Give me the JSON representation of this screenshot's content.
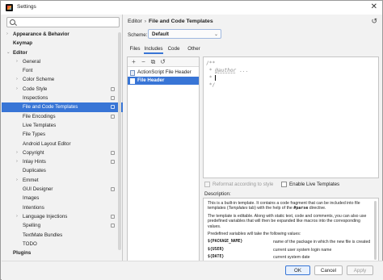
{
  "window": {
    "title": "Settings",
    "close": "✕"
  },
  "sidebar": {
    "items": [
      {
        "label": "Appearance & Behavior",
        "bold": true,
        "arrow": "›",
        "indent": 0,
        "proj": false,
        "selected": false
      },
      {
        "label": "Keymap",
        "bold": true,
        "arrow": "",
        "indent": 0,
        "proj": false,
        "selected": false
      },
      {
        "label": "Editor",
        "bold": true,
        "arrow": "⌄",
        "indent": 0,
        "proj": false,
        "selected": false
      },
      {
        "label": "General",
        "bold": false,
        "arrow": "›",
        "indent": 1,
        "proj": false,
        "selected": false
      },
      {
        "label": "Font",
        "bold": false,
        "arrow": "",
        "indent": 1,
        "proj": false,
        "selected": false
      },
      {
        "label": "Color Scheme",
        "bold": false,
        "arrow": "›",
        "indent": 1,
        "proj": false,
        "selected": false
      },
      {
        "label": "Code Style",
        "bold": false,
        "arrow": "›",
        "indent": 1,
        "proj": true,
        "selected": false
      },
      {
        "label": "Inspections",
        "bold": false,
        "arrow": "",
        "indent": 1,
        "proj": true,
        "selected": false
      },
      {
        "label": "File and Code Templates",
        "bold": false,
        "arrow": "",
        "indent": 1,
        "proj": true,
        "selected": true
      },
      {
        "label": "File Encodings",
        "bold": false,
        "arrow": "",
        "indent": 1,
        "proj": true,
        "selected": false
      },
      {
        "label": "Live Templates",
        "bold": false,
        "arrow": "",
        "indent": 1,
        "proj": false,
        "selected": false
      },
      {
        "label": "File Types",
        "bold": false,
        "arrow": "",
        "indent": 1,
        "proj": false,
        "selected": false
      },
      {
        "label": "Android Layout Editor",
        "bold": false,
        "arrow": "",
        "indent": 1,
        "proj": false,
        "selected": false
      },
      {
        "label": "Copyright",
        "bold": false,
        "arrow": "›",
        "indent": 1,
        "proj": true,
        "selected": false
      },
      {
        "label": "Inlay Hints",
        "bold": false,
        "arrow": "›",
        "indent": 1,
        "proj": true,
        "selected": false
      },
      {
        "label": "Duplicates",
        "bold": false,
        "arrow": "",
        "indent": 1,
        "proj": false,
        "selected": false
      },
      {
        "label": "Emmet",
        "bold": false,
        "arrow": "›",
        "indent": 1,
        "proj": false,
        "selected": false
      },
      {
        "label": "GUI Designer",
        "bold": false,
        "arrow": "",
        "indent": 1,
        "proj": true,
        "selected": false
      },
      {
        "label": "Images",
        "bold": false,
        "arrow": "",
        "indent": 1,
        "proj": false,
        "selected": false
      },
      {
        "label": "Intentions",
        "bold": false,
        "arrow": "",
        "indent": 1,
        "proj": false,
        "selected": false
      },
      {
        "label": "Language Injections",
        "bold": false,
        "arrow": "›",
        "indent": 1,
        "proj": true,
        "selected": false
      },
      {
        "label": "Spelling",
        "bold": false,
        "arrow": "",
        "indent": 1,
        "proj": true,
        "selected": false
      },
      {
        "label": "TextMate Bundles",
        "bold": false,
        "arrow": "",
        "indent": 1,
        "proj": false,
        "selected": false
      },
      {
        "label": "TODO",
        "bold": false,
        "arrow": "",
        "indent": 1,
        "proj": false,
        "selected": false
      },
      {
        "label": "Plugins",
        "bold": true,
        "arrow": "",
        "indent": 0,
        "proj": false,
        "selected": false
      }
    ],
    "help": "?"
  },
  "breadcrumb": {
    "parent": "Editor",
    "sep": "›",
    "current": "File and Code Templates"
  },
  "reset_icon": "↺",
  "scheme": {
    "label": "Scheme:",
    "value": "Default",
    "chevron": "⌄"
  },
  "tabs": [
    "Files",
    "Includes",
    "Code",
    "Other"
  ],
  "active_tab": 1,
  "toolbar": {
    "add": "+",
    "remove": "−",
    "copy": "⧉",
    "reset": "↺"
  },
  "templates": [
    {
      "label": "ActionScript File Header",
      "selected": false
    },
    {
      "label": "File Header",
      "selected": true
    }
  ],
  "editor": {
    "line1": "/**",
    "line2_prefix": " * ",
    "line2_tag": "@author",
    "line2_suffix": " ...",
    "line3_prefix": " * ",
    "line4": " */"
  },
  "options": {
    "reformat": "Reformat according to style",
    "live_templates": "Enable Live Templates"
  },
  "description": {
    "label": "Description:",
    "p1a": "This is a built-in template. It contains a code fragment that can be included into file templates (",
    "p1b": "Templates",
    "p1c": " tab) with the help of the ",
    "p1d": "#parse",
    "p1e": " directive.",
    "p2": "The template is editable. Along with static text, code and comments, you can also use predefined variables that will then be expanded like macros into the corresponding values.",
    "p3": "Predefined variables will take the following values:",
    "vars": [
      {
        "name": "${PACKAGE_NAME}",
        "desc": "name of the package in which the new file is created"
      },
      {
        "name": "${USER}",
        "desc": "current user system login name"
      },
      {
        "name": "${DATE}",
        "desc": "current system date"
      }
    ]
  },
  "buttons": {
    "ok": "OK",
    "cancel": "Cancel",
    "apply": "Apply"
  }
}
